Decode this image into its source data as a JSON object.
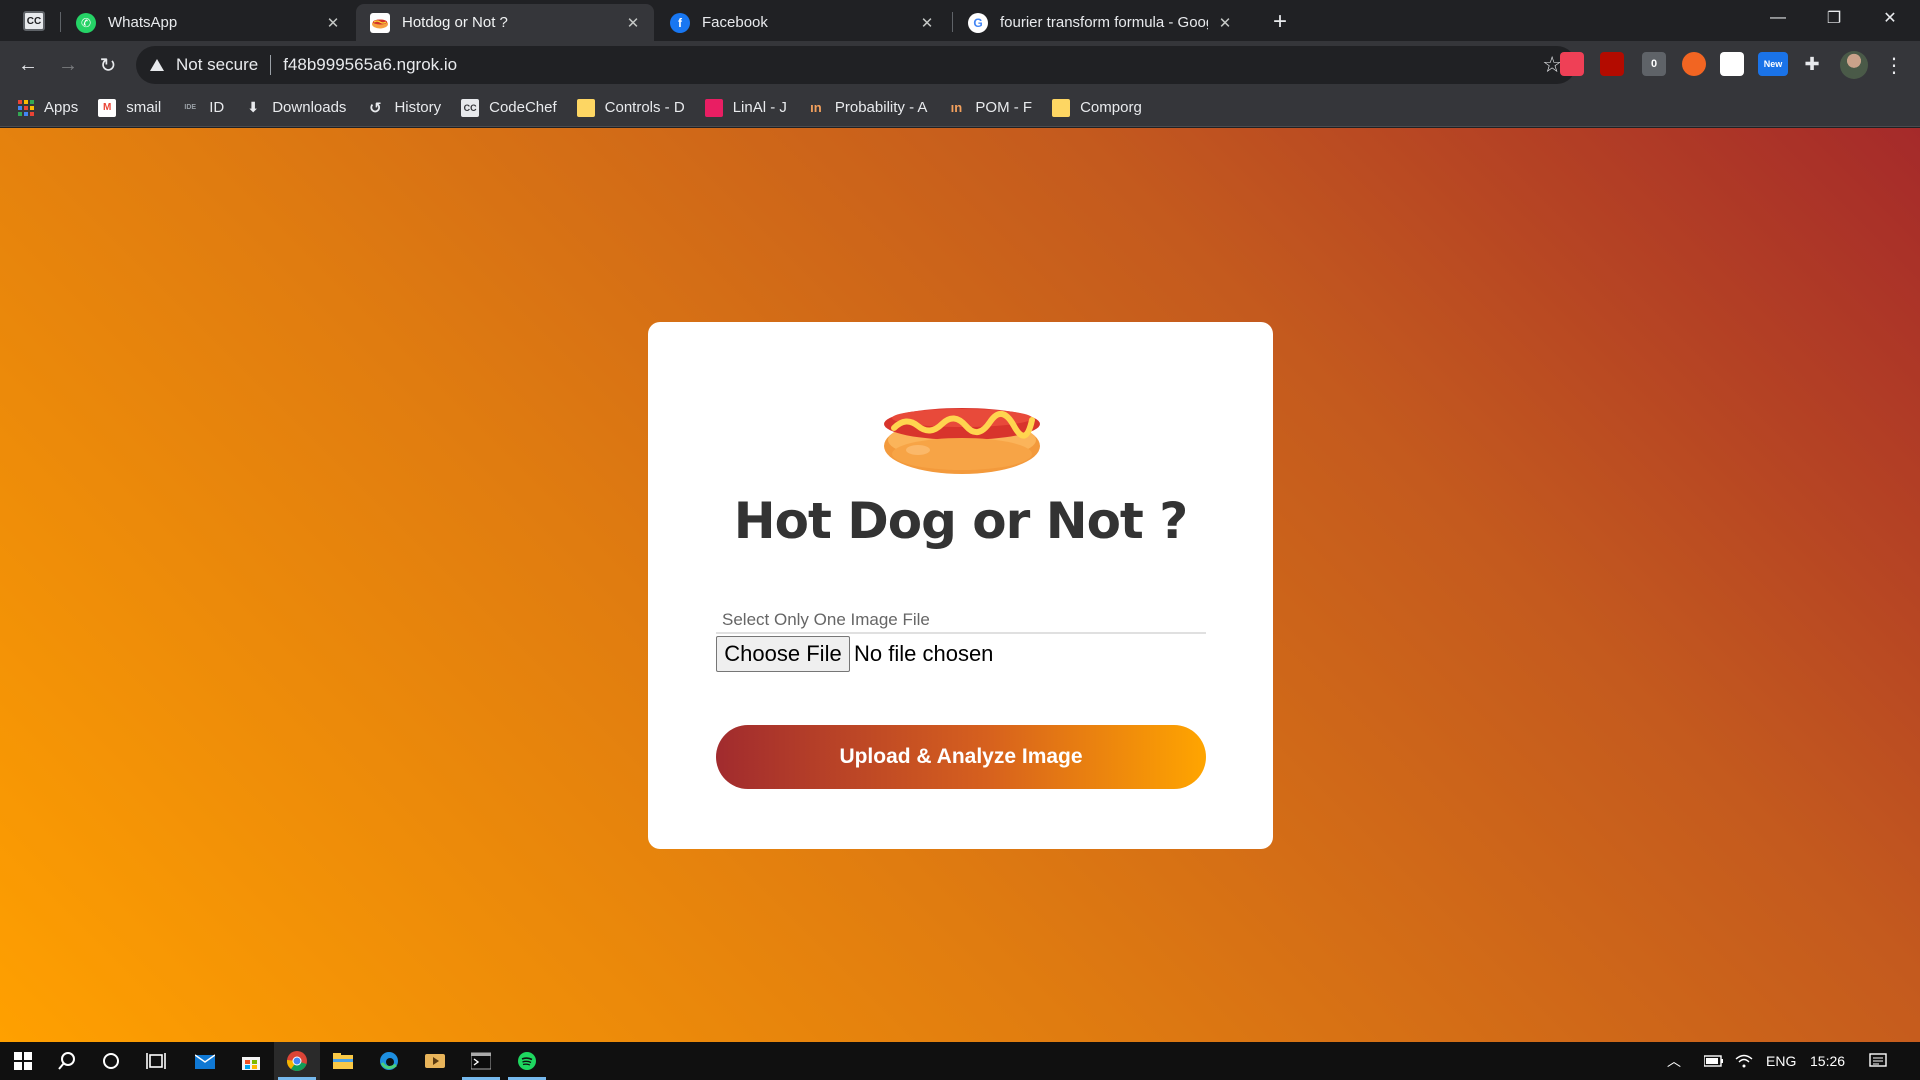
{
  "browser": {
    "tabs": [
      {
        "title": "WhatsApp",
        "icon": "whatsapp-icon",
        "color": "#25d366"
      },
      {
        "title": "Hotdog or Not ?",
        "icon": "hotdog-favicon",
        "color": "#ff9800",
        "active": true
      },
      {
        "title": "Facebook",
        "icon": "facebook-icon",
        "color": "#1877f2"
      },
      {
        "title": "fourier transform formula - Goog",
        "icon": "google-icon",
        "color": "#4285f4"
      }
    ],
    "pinned_tab_label": "CC",
    "new_tab_symbol": "+",
    "window_controls": {
      "minimize": "—",
      "restore": "❐",
      "close": "✕"
    },
    "address": {
      "security_label": "Not secure",
      "url": "f48b999565a6.ngrok.io"
    },
    "extensions": [
      {
        "name": "pocket-icon",
        "label": "",
        "color": "#ef4056"
      },
      {
        "name": "acrobat-icon",
        "label": "",
        "color": "#b30b00"
      },
      {
        "name": "badge-extension-icon",
        "label": "0",
        "color": "#5f6368"
      },
      {
        "name": "orange-extension-icon",
        "label": "",
        "color": "#f26522"
      },
      {
        "name": "flag-extension-icon",
        "label": "",
        "color": "#ffffff"
      },
      {
        "name": "new-extension-icon",
        "label": "New",
        "color": "#1a73e8"
      },
      {
        "name": "puzzle-icon",
        "label": "",
        "color": "#e8eaed"
      }
    ],
    "bookmarks": [
      {
        "label": "Apps",
        "icon": "apps-grid-icon"
      },
      {
        "label": "smail",
        "icon": "gmail-icon",
        "badge": "M",
        "color": "#ea4335"
      },
      {
        "label": "ID",
        "icon": "ideone-icon",
        "badge": "IDE",
        "color": "#9aa0a6"
      },
      {
        "label": "Downloads",
        "icon": "download-icon",
        "badge": "⬇",
        "color": "#e8eaed"
      },
      {
        "label": "History",
        "icon": "history-icon",
        "badge": "↺",
        "color": "#e8eaed"
      },
      {
        "label": "CodeChef",
        "icon": "codechef-icon",
        "badge": "CC",
        "color": "#e8eaed"
      },
      {
        "label": "Controls - D",
        "icon": "doc-icon",
        "badge": "",
        "color": "#fdd663"
      },
      {
        "label": "LinAl - J",
        "icon": "profile-icon",
        "badge": "",
        "color": "#e91e63"
      },
      {
        "label": "Probability - A",
        "icon": "overleaf-icon",
        "badge": "ın",
        "color": "#f4a15d"
      },
      {
        "label": "POM - F",
        "icon": "overleaf-icon",
        "badge": "ın",
        "color": "#f4a15d"
      },
      {
        "label": "Comporg",
        "icon": "doc-icon",
        "badge": "",
        "color": "#fdd663"
      }
    ]
  },
  "page": {
    "heading": "Hot Dog or Not ?",
    "file_field_label": "Select Only One Image File",
    "choose_file_label": "Choose File",
    "no_file_text": "No file chosen",
    "upload_button_label": "Upload & Analyze Image",
    "colors": {
      "gradient_start": "#ffa000",
      "gradient_end": "#a52a2a",
      "button_start": "#a12b2e",
      "button_end": "#ffa500"
    }
  },
  "taskbar": {
    "apps": [
      "start-icon",
      "search-icon",
      "cortana-icon",
      "task-view-icon",
      "mail-icon",
      "store-icon",
      "chrome-icon",
      "file-explorer-icon",
      "edge-icon",
      "media-player-icon",
      "terminal-icon",
      "spotify-icon"
    ],
    "language": "ENG",
    "time": "15:26"
  }
}
